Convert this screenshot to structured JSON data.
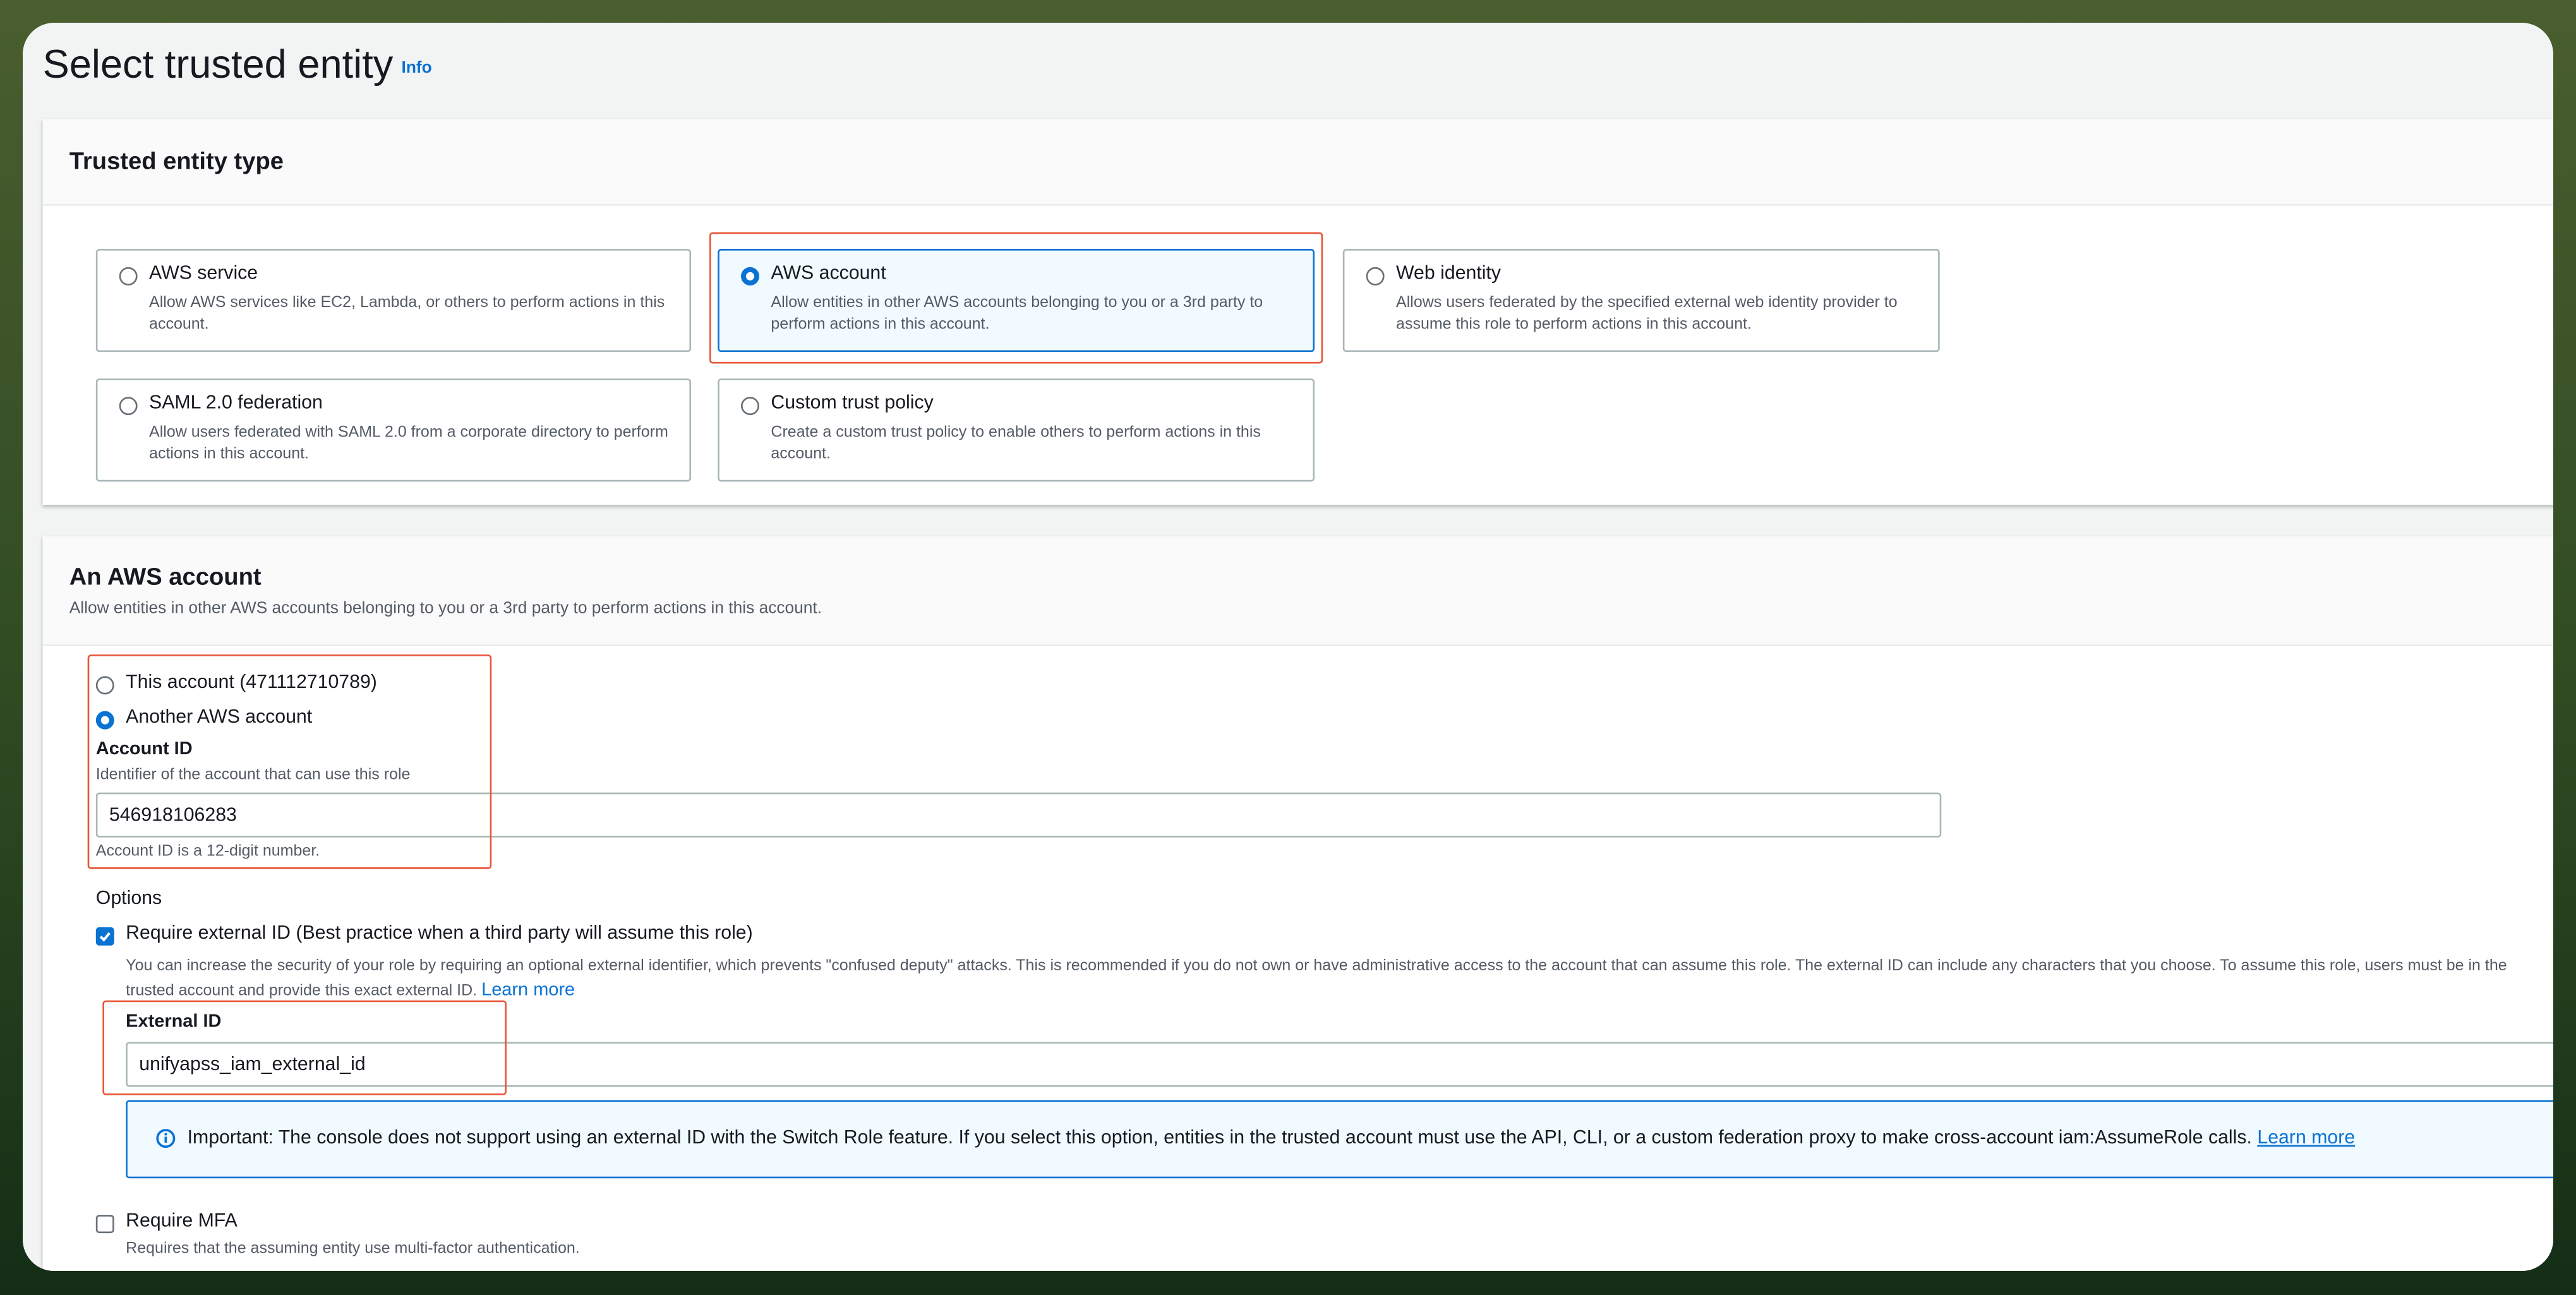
{
  "page": {
    "title": "Select trusted entity",
    "info_link": "Info"
  },
  "trusted_entity_type": {
    "title": "Trusted entity type",
    "options": [
      {
        "title": "AWS service",
        "description": "Allow AWS services like EC2, Lambda, or others to perform actions in this account.",
        "selected": false
      },
      {
        "title": "AWS account",
        "description": "Allow entities in other AWS accounts belonging to you or a 3rd party to perform actions in this account.",
        "selected": true
      },
      {
        "title": "Web identity",
        "description": "Allows users federated by the specified external web identity provider to assume this role to perform actions in this account.",
        "selected": false
      },
      {
        "title": "SAML 2.0 federation",
        "description": "Allow users federated with SAML 2.0 from a corporate directory to perform actions in this account.",
        "selected": false
      },
      {
        "title": "Custom trust policy",
        "description": "Create a custom trust policy to enable others to perform actions in this account.",
        "selected": false
      }
    ]
  },
  "aws_account": {
    "title": "An AWS account",
    "description": "Allow entities in other AWS accounts belonging to you or a 3rd party to perform actions in this account.",
    "this_account_label": "This account (471112710789)",
    "another_account_label": "Another AWS account",
    "account_id_label": "Account ID",
    "account_id_desc": "Identifier of the account that can use this role",
    "account_id_value": "546918106283",
    "account_id_hint": "Account ID is a 12-digit number.",
    "options_label": "Options",
    "require_external_id_label": "Require external ID (Best practice when a third party will assume this role)",
    "require_external_id_desc": "You can increase the security of your role by requiring an optional external identifier, which prevents \"confused deputy\" attacks. This is recommended if you do not own or have administrative access to the account that can assume this role. The external ID can include any characters that you choose. To assume this role, users must be in the trusted account and provide this exact external ID.",
    "learn_more": "Learn more",
    "external_id_label": "External ID",
    "external_id_value": "unifyapss_iam_external_id",
    "alert_text": "Important: The console does not support using an external ID with the Switch Role feature. If you select this option, entities in the trusted account must use the API, CLI, or a custom federation proxy to make cross-account iam:AssumeRole calls.",
    "alert_link": "Learn more",
    "require_mfa_label": "Require MFA",
    "require_mfa_desc": "Requires that the assuming entity use multi-factor authentication."
  },
  "colors": {
    "accent": "#0972d3",
    "highlight": "#e85537"
  }
}
